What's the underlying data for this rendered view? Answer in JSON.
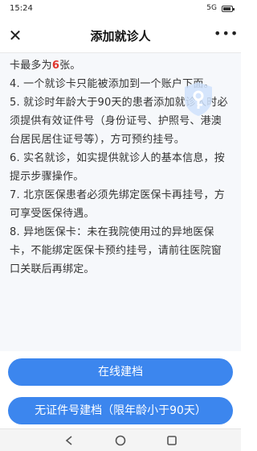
{
  "status_bar": {
    "time": "15:24",
    "signal": "5G"
  },
  "nav": {
    "title": "添加就诊人",
    "close_icon": "close-icon",
    "more_icon": "more-icon"
  },
  "notes": {
    "line1_pre": "卡最多为",
    "line1_num": "6",
    "line1_post": "张。",
    "item4": "4. 一个就诊卡只能被添加到一个账户下面。",
    "item5": "5. 就诊时年龄大于90天的患者添加就诊人时必须提供有效证件号（身份证号、护照号、港澳台居民居住证号等），方可预约挂号。",
    "item6": "6. 实名就诊，如实提供就诊人的基本信息，按提示步骤操作。",
    "item7": "7. 北京医保患者必须先绑定医保卡再挂号，方可享受医保待遇。",
    "item8": "8. 异地医保卡：未在我院使用过的异地医保卡，不能绑定医保卡预约挂号，请前往医院窗口关联后再绑定。"
  },
  "buttons": {
    "online": "在线建档",
    "no_id": "无证件号建档（限年龄小于90天）"
  },
  "colors": {
    "accent": "#3c86ee",
    "highlight": "#e0342c"
  }
}
